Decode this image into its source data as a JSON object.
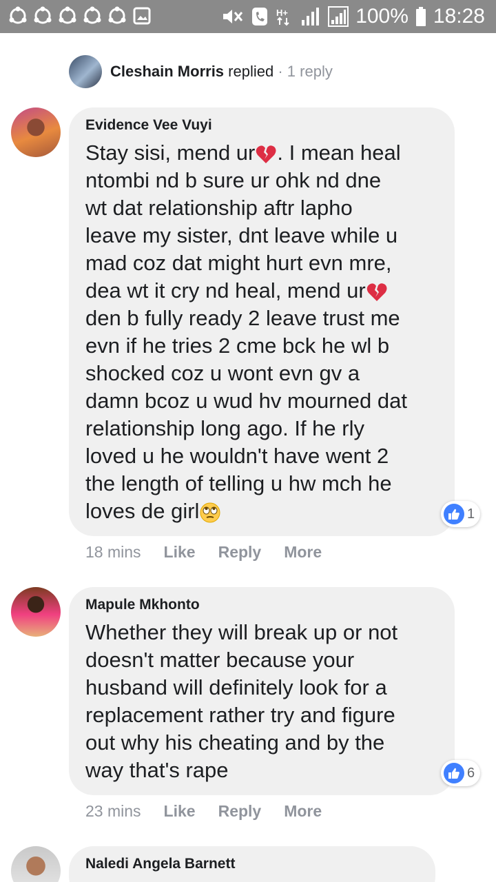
{
  "status_bar": {
    "battery": "100%",
    "time": "18:28",
    "network": "H+",
    "notification_icons": [
      "sync-icon",
      "sync-icon",
      "sync-icon",
      "sync-icon",
      "sync-icon",
      "gallery-icon"
    ]
  },
  "reply_header": {
    "name": "Cleshain Morris",
    "verb": "replied",
    "separator": "·",
    "count": "1 reply"
  },
  "comments": [
    {
      "author": "Evidence Vee Vuyi",
      "lines": [
        "Stay sisi, mend ur",
        ". I mean heal",
        "ntombi nd b sure ur ohk nd dne",
        "wt dat relationship aftr lapho",
        "leave my sister, dnt leave while u",
        "mad coz dat might hurt evn mre,",
        "dea wt it cry nd heal, mend ur",
        "den b fully ready 2 leave trust me",
        "evn if he tries 2 cme bck he wl b",
        "shocked coz u wont evn gv a",
        "damn bcoz u wud hv mourned dat",
        "relationship long ago. If he rly",
        "loved u he wouldn't have went 2",
        "the length of telling u hw mch he",
        "loves de girl"
      ],
      "emojis": [
        "broken-heart-emoji",
        "broken-heart-emoji",
        "rolling-eyes-emoji"
      ],
      "likes": "1",
      "time": "18 mins",
      "like_label": "Like",
      "reply_label": "Reply",
      "more_label": "More"
    },
    {
      "author": "Mapule Mkhonto",
      "lines": [
        "Whether they will break up or not",
        "doesn't matter because your",
        "husband will definitely look for a",
        "replacement rather try and figure",
        "out why his cheating and by the",
        "way that's rape"
      ],
      "likes": "6",
      "time": "23 mins",
      "like_label": "Like",
      "reply_label": "Reply",
      "more_label": "More"
    },
    {
      "author": "Naledi Angela Barnett"
    }
  ],
  "colors": {
    "status_bar": "#8a8a8a",
    "bubble": "#f0f0f0",
    "like_blue": "#4080ff",
    "meta_gray": "#90949c"
  }
}
